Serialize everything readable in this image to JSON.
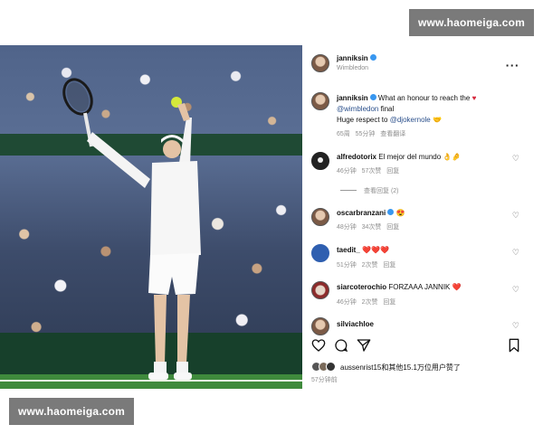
{
  "watermarks": {
    "top": "www.haomeiga.com",
    "bottom": "www.haomeiga.com"
  },
  "post": {
    "username": "janniksin",
    "location": "Wimbledon",
    "more_label": "···"
  },
  "caption": {
    "username": "janniksin",
    "line1_text": "What an honour to reach the",
    "line2_mention": "@wimbledon",
    "line2_text": "final",
    "line3_text": "Huge respect to",
    "line3_mention": "@djokernole",
    "time": "65周",
    "likes": "55分钟",
    "translate": "查看翻译"
  },
  "comments": [
    {
      "username": "alfredotorix",
      "text": "El mejor del mundo",
      "emoji": "👌🤌",
      "time": "46分钟",
      "likes": "57次赞",
      "reply": "回复"
    },
    {
      "view_replies": "查看回复 (2)"
    },
    {
      "username": "oscarbranzani",
      "text": "",
      "emoji": "😍",
      "time": "48分钟",
      "likes": "34次赞",
      "reply": "回复"
    },
    {
      "username": "taedit_",
      "text": "",
      "emoji": "❤️❤️❤️",
      "time": "51分钟",
      "likes": "2次赞",
      "reply": "回复"
    },
    {
      "username": "siarcoterochio",
      "text": "FORZAAA JANNIK",
      "emoji": "❤️",
      "time": "46分钟",
      "likes": "2次赞",
      "reply": "回复"
    },
    {
      "username": "silviachloe",
      "text": "",
      "emoji": "",
      "time": "",
      "likes": "",
      "reply": ""
    }
  ],
  "footer": {
    "liked_by": "aussenrist15和其他15.1万位用户赞了",
    "time_ago": "57分钟前"
  },
  "icons": {
    "like": "heart-outline-icon",
    "comment": "comment-bubble-icon",
    "share": "send-arrow-icon",
    "save": "bookmark-icon"
  },
  "colors": {
    "verified": "#3897f0",
    "heart": "#d6263b",
    "mention": "#2a4f8b",
    "watermark_bg": "#7a7a7a"
  }
}
